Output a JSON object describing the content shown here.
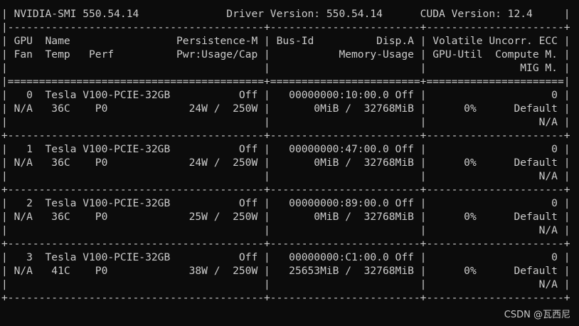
{
  "header": {
    "line": "| NVIDIA-SMI 550.54.14              Driver Version: 550.54.14      CUDA Version: 12.4     |",
    "tool": "NVIDIA-SMI",
    "tool_version": "550.54.14",
    "driver_version_label": "Driver Version:",
    "driver_version": "550.54.14",
    "cuda_version_label": "CUDA Version:",
    "cuda_version": "12.4"
  },
  "separators": {
    "dash": "|-----------------------------------------+------------------------+----------------------+",
    "equals": "|=========================================+========================+======================|",
    "row_end": "+-----------------------------------------+------------------------+----------------------+"
  },
  "column_headers": [
    "| GPU  Name                 Persistence-M | Bus-Id          Disp.A | Volatile Uncorr. ECC |",
    "| Fan  Temp   Perf          Pwr:Usage/Cap |           Memory-Usage | GPU-Util  Compute M. |",
    "|                                         |                        |               MIG M. |"
  ],
  "gpus": [
    {
      "line1": "|   0  Tesla V100-PCIE-32GB           Off |   00000000:10:00.0 Off |                    0 |",
      "line2": "| N/A   36C    P0             24W /  250W |       0MiB /  32768MiB |      0%      Default |",
      "line3": "|                                         |                        |                  N/A |",
      "index": "0",
      "name": "Tesla V100-PCIE-32GB",
      "persistence": "Off",
      "bus_id": "00000000:10:00.0",
      "disp": "Off",
      "ecc": "0",
      "fan": "N/A",
      "temp": "36C",
      "perf": "P0",
      "power_usage": "24W",
      "power_cap": "250W",
      "memory_used": "0MiB",
      "memory_total": "32768MiB",
      "gpu_util": "0%",
      "compute_mode": "Default",
      "mig_mode": "N/A"
    },
    {
      "line1": "|   1  Tesla V100-PCIE-32GB           Off |   00000000:47:00.0 Off |                    0 |",
      "line2": "| N/A   36C    P0             24W /  250W |       0MiB /  32768MiB |      0%      Default |",
      "line3": "|                                         |                        |                  N/A |",
      "index": "1",
      "name": "Tesla V100-PCIE-32GB",
      "persistence": "Off",
      "bus_id": "00000000:47:00.0",
      "disp": "Off",
      "ecc": "0",
      "fan": "N/A",
      "temp": "36C",
      "perf": "P0",
      "power_usage": "24W",
      "power_cap": "250W",
      "memory_used": "0MiB",
      "memory_total": "32768MiB",
      "gpu_util": "0%",
      "compute_mode": "Default",
      "mig_mode": "N/A"
    },
    {
      "line1": "|   2  Tesla V100-PCIE-32GB           Off |   00000000:89:00.0 Off |                    0 |",
      "line2": "| N/A   36C    P0             25W /  250W |       0MiB /  32768MiB |      0%      Default |",
      "line3": "|                                         |                        |                  N/A |",
      "index": "2",
      "name": "Tesla V100-PCIE-32GB",
      "persistence": "Off",
      "bus_id": "00000000:89:00.0",
      "disp": "Off",
      "ecc": "0",
      "fan": "N/A",
      "temp": "36C",
      "perf": "P0",
      "power_usage": "25W",
      "power_cap": "250W",
      "memory_used": "0MiB",
      "memory_total": "32768MiB",
      "gpu_util": "0%",
      "compute_mode": "Default",
      "mig_mode": "N/A"
    },
    {
      "line1": "|   3  Tesla V100-PCIE-32GB           Off |   00000000:C1:00.0 Off |                    0 |",
      "line2": "| N/A   41C    P0             38W /  250W |   25653MiB /  32768MiB |      0%      Default |",
      "line3": "|                                         |                        |                  N/A |",
      "index": "3",
      "name": "Tesla V100-PCIE-32GB",
      "persistence": "Off",
      "bus_id": "00000000:C1:00.0",
      "disp": "Off",
      "ecc": "0",
      "fan": "N/A",
      "temp": "41C",
      "perf": "P0",
      "power_usage": "38W",
      "power_cap": "250W",
      "memory_used": "25653MiB",
      "memory_total": "32768MiB",
      "gpu_util": "0%",
      "compute_mode": "Default",
      "mig_mode": "N/A"
    }
  ],
  "watermark": "CSDN @瓦西尼",
  "colors": {
    "background": "#0c0c0c",
    "text": "#cccccc"
  }
}
